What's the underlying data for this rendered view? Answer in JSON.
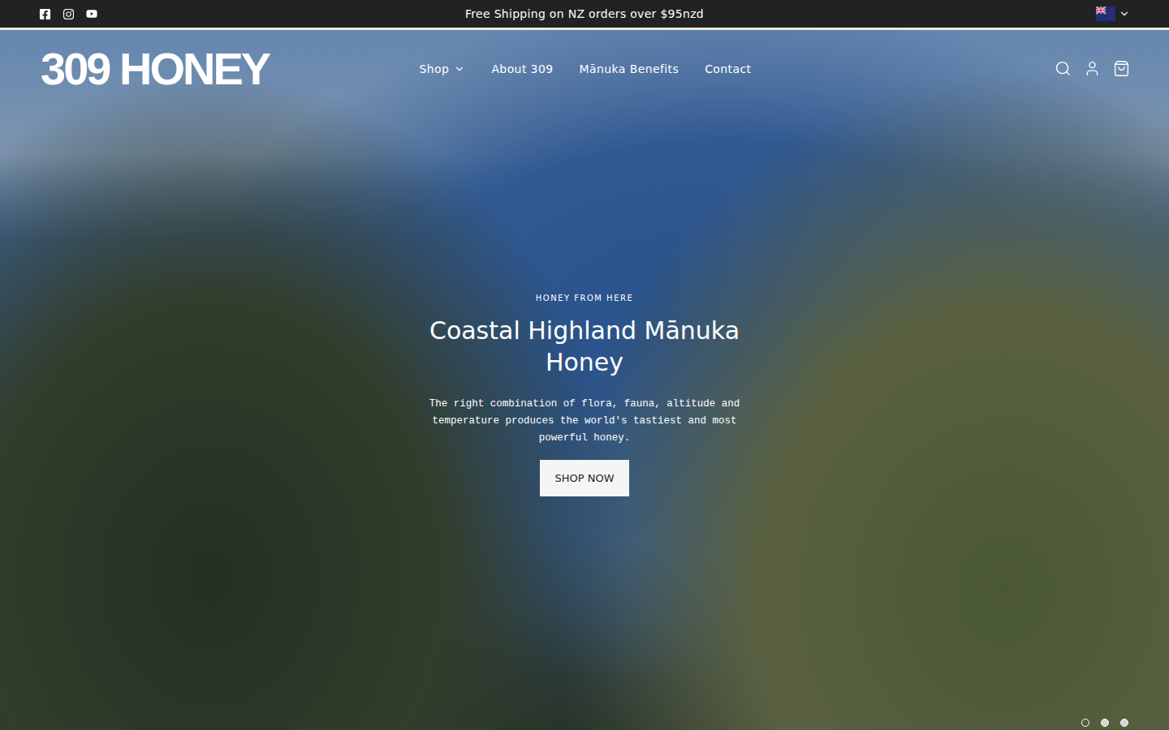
{
  "announcement": {
    "text": "Free Shipping on NZ orders over $95nzd"
  },
  "logo": "309 HONEY",
  "nav": [
    {
      "label": "Shop",
      "kind": "dropdown"
    },
    {
      "label": "About 309",
      "kind": "link"
    },
    {
      "label": "Mānuka Benefits",
      "kind": "link"
    },
    {
      "label": "Contact",
      "kind": "link"
    }
  ],
  "hero": {
    "eyebrow": "HONEY FROM HERE",
    "title": "Coastal Highland Mānuka Honey",
    "text": "The right combination of flora, fauna, altitude and temperature produces the world's tastiest and most powerful honey.",
    "button": "SHOP NOW"
  },
  "slides": [
    {
      "selected": true
    },
    {
      "selected": false
    },
    {
      "selected": false
    }
  ]
}
